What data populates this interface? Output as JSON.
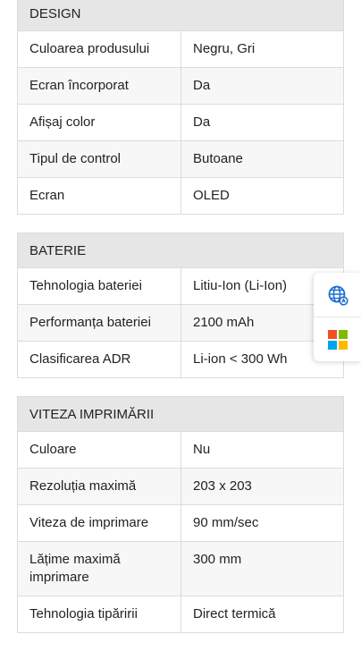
{
  "sections": [
    {
      "title": "DESIGN",
      "rows": [
        {
          "label": "Culoarea produsului",
          "value": "Negru, Gri"
        },
        {
          "label": "Ecran încorporat",
          "value": "Da"
        },
        {
          "label": "Afișaj color",
          "value": "Da"
        },
        {
          "label": "Tipul de control",
          "value": "Butoane"
        },
        {
          "label": "Ecran",
          "value": "OLED"
        }
      ]
    },
    {
      "title": "BATERIE",
      "rows": [
        {
          "label": "Tehnologia bateriei",
          "value": "Litiu-Ion (Li-Ion)"
        },
        {
          "label": "Performanța bateriei",
          "value": "2100 mAh"
        },
        {
          "label": "Clasificarea ADR",
          "value": "Li-ion < 300 Wh"
        }
      ]
    },
    {
      "title": "VITEZA IMPRIMĂRII",
      "rows": [
        {
          "label": "Culoare",
          "value": "Nu"
        },
        {
          "label": "Rezoluția maximă",
          "value": "203 x 203"
        },
        {
          "label": "Viteza de imprimare",
          "value": "90 mm/sec"
        },
        {
          "label": "Lățime maximă imprimare",
          "value": "300 mm"
        },
        {
          "label": "Tehnologia tipăririi",
          "value": "Direct termică"
        }
      ]
    }
  ],
  "side_widget": {
    "buttons": [
      {
        "icon": "translate-globe-icon",
        "color": "#1f6fd1"
      },
      {
        "icon": "microsoft-logo-icon",
        "colors": [
          "#f25022",
          "#7fba00",
          "#00a4ef",
          "#ffb900"
        ]
      }
    ]
  }
}
